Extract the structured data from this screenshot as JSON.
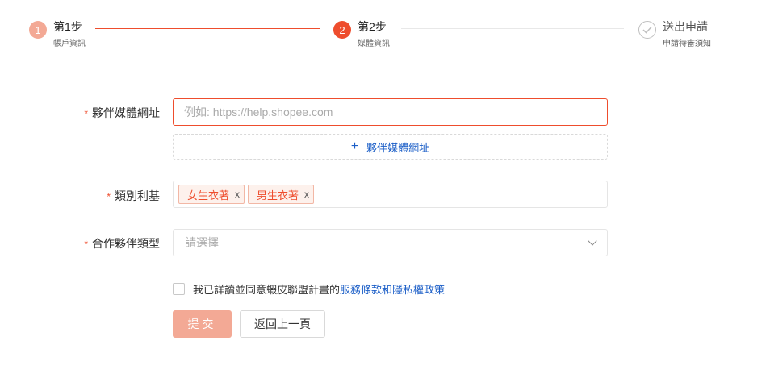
{
  "steps": [
    {
      "number": "1",
      "title": "第1步",
      "subtitle": "帳戶資訊",
      "state": "done"
    },
    {
      "number": "2",
      "title": "第2步",
      "subtitle": "媒體資訊",
      "state": "active"
    },
    {
      "number": "✓",
      "title": "送出申請",
      "subtitle": "申請待審須知",
      "state": "todo"
    }
  ],
  "colors": {
    "accent": "#ee4d2d",
    "accent_light": "#f3a995",
    "link": "#1b5ec7"
  },
  "form": {
    "media_url": {
      "required_mark": "*",
      "label": "夥伴媒體網址",
      "placeholder": "例如: https://help.shopee.com",
      "value": ""
    },
    "add_media_url": {
      "icon": "plus-icon",
      "label": "夥伴媒體網址"
    },
    "category": {
      "required_mark": "*",
      "label": "類別利基",
      "tags": [
        {
          "label": "女生衣著",
          "remove": "x"
        },
        {
          "label": "男生衣著",
          "remove": "x"
        }
      ]
    },
    "partner_type": {
      "required_mark": "*",
      "label": "合作夥伴類型",
      "placeholder": "請選擇",
      "icon": "chevron-down-icon"
    },
    "agreement": {
      "text": "我已詳讀並同意蝦皮聯盟計畫的",
      "link": "服務條款和隱私權政策",
      "checked": false
    },
    "submit_label": "提交",
    "back_label": "返回上一頁"
  }
}
